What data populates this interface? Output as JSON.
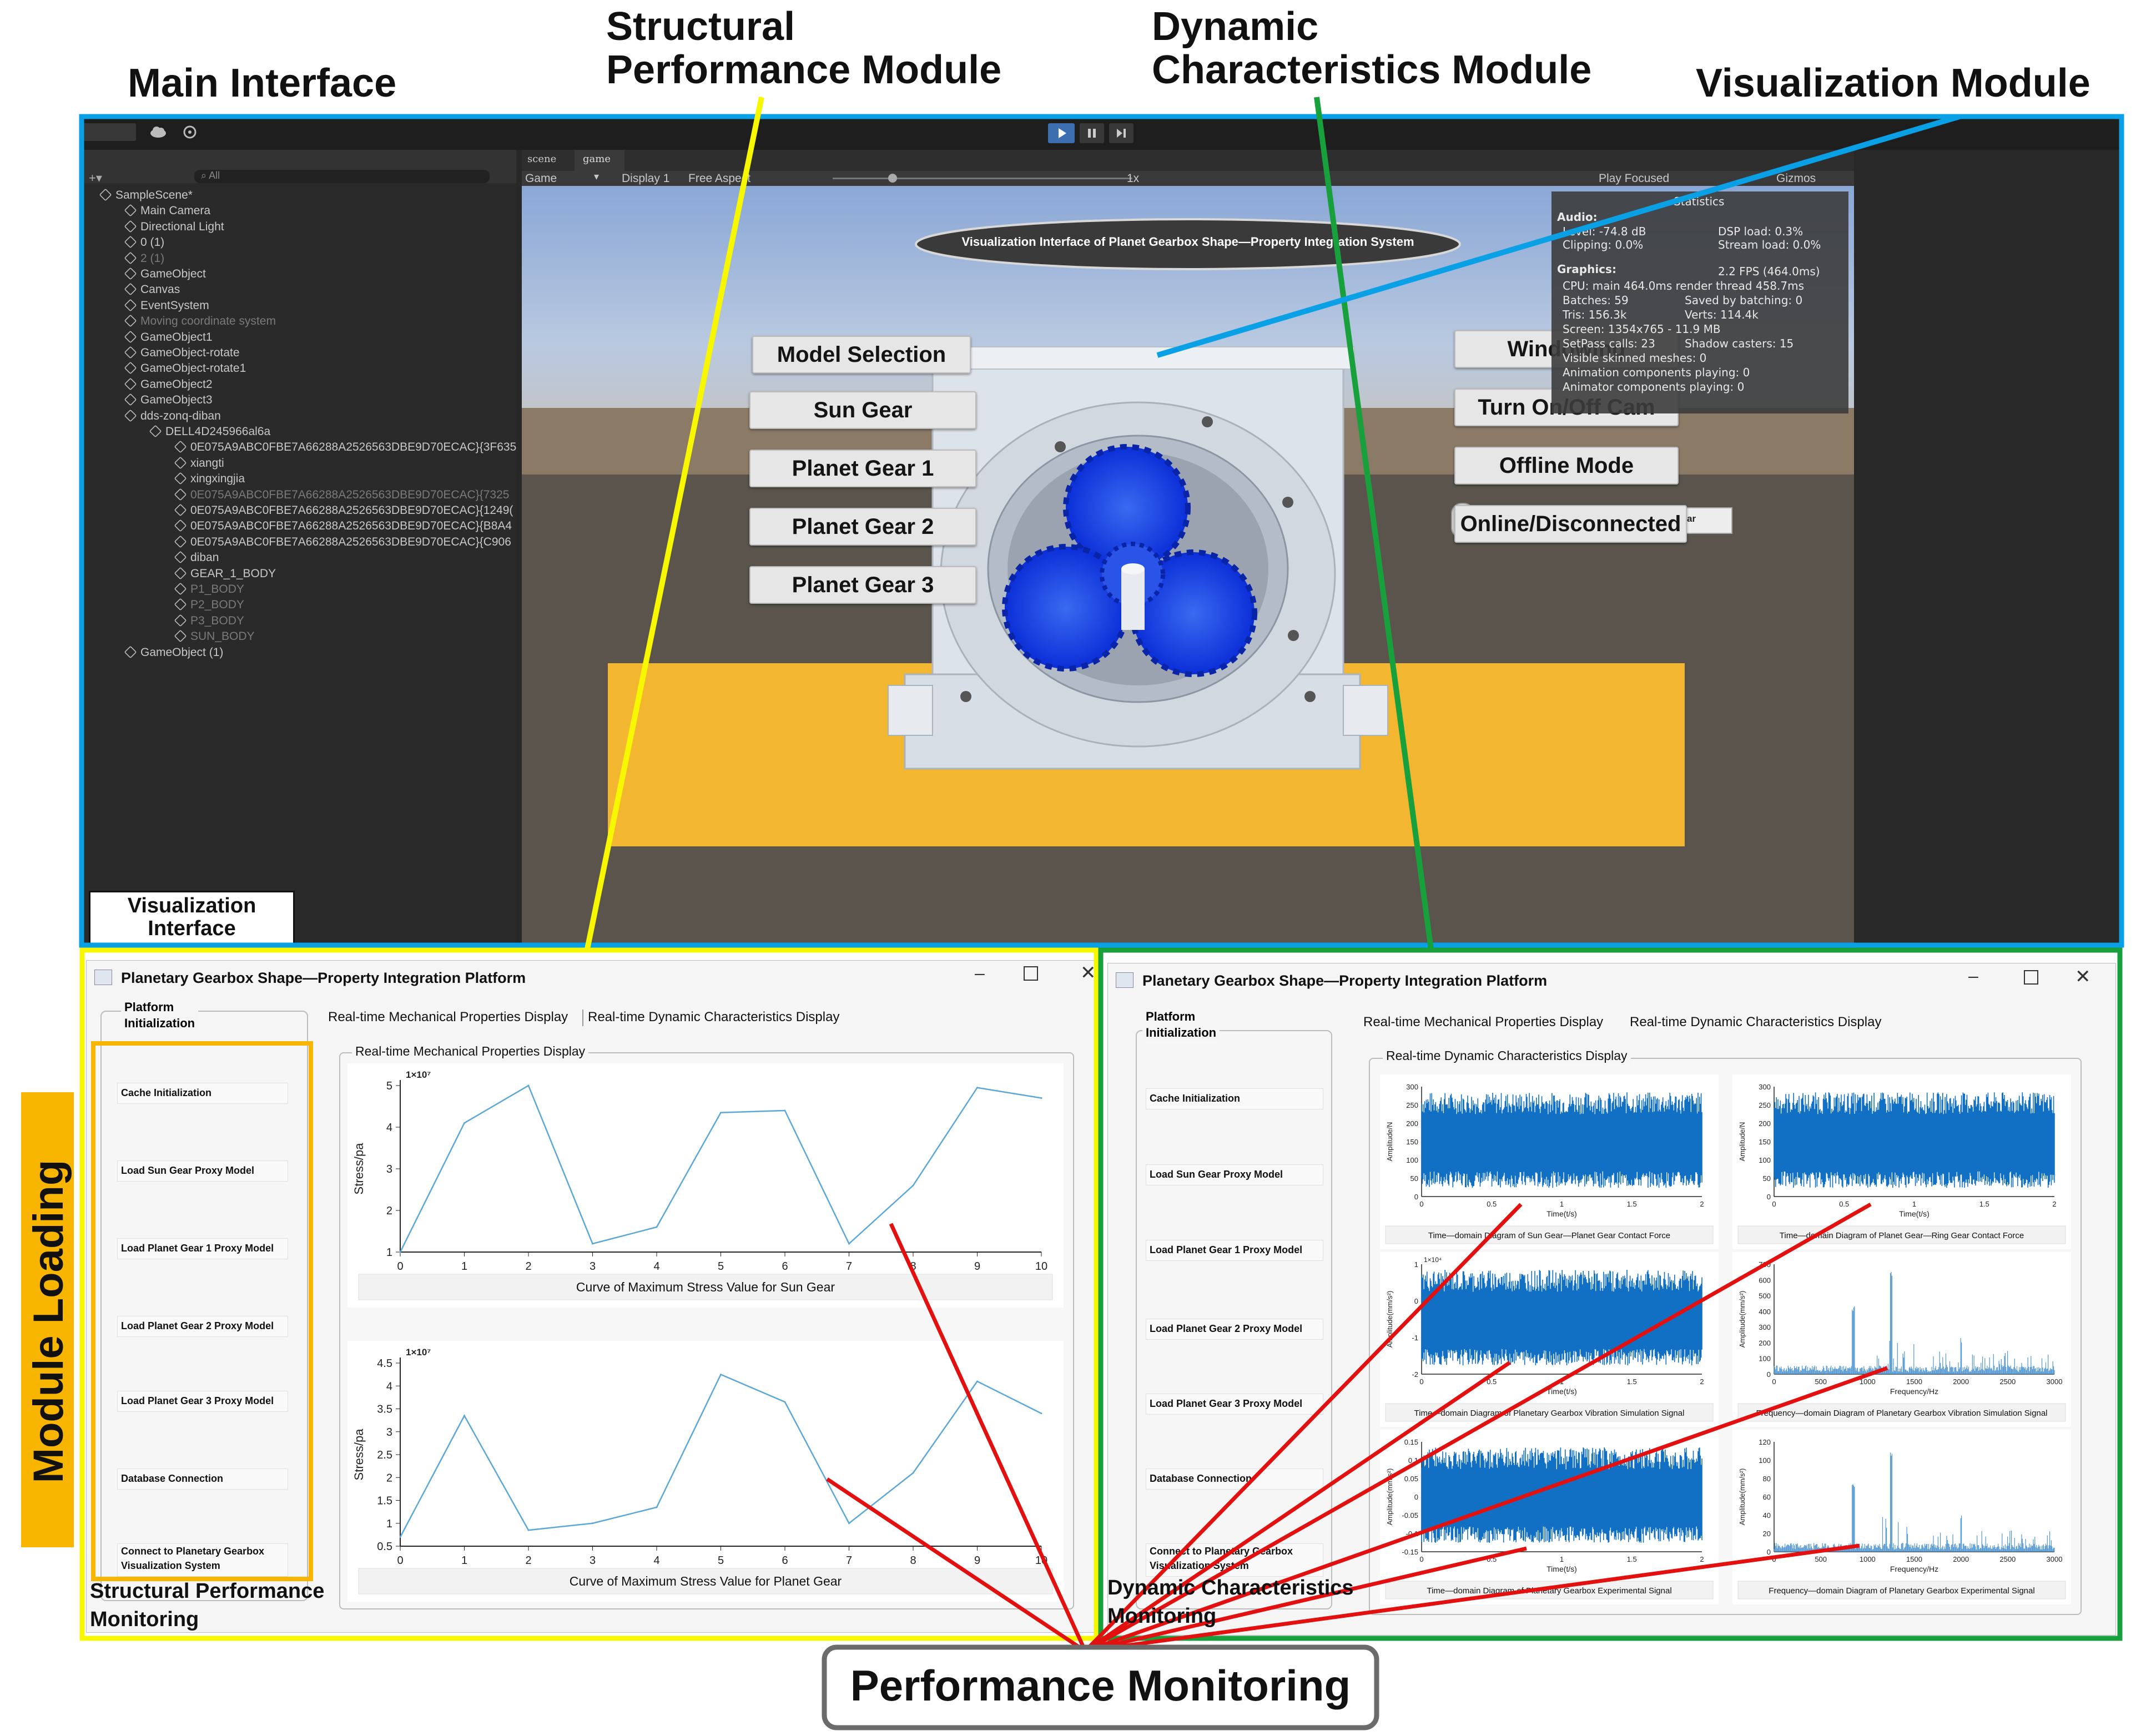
{
  "callouts": {
    "main_interface": "Main Interface",
    "structural": "Structural\nPerformance Module",
    "dynamic": "Dynamic\nCharacteristics Module",
    "visualization_module": "Visualization Module",
    "module_loading": "Module Loading",
    "visualization_interface": "Visualization\nInterface",
    "structural_monitoring": "Structural Performance\nMonitoring",
    "dynamic_monitoring": "Dynamic Characteristics\nMonitoring",
    "performance_monitoring": "Performance Monitoring"
  },
  "colors": {
    "blue_frame": "#0aa0e6",
    "yellow_frame": "#f7f700",
    "green_frame": "#17a03c",
    "orange": "#f7b500",
    "red_lines": "#e31010",
    "plot_line": "#5aa7d8",
    "signal": "#1170c4"
  },
  "unity": {
    "tabs": {
      "scene": "scene",
      "game": "game"
    },
    "toolbar": {
      "game": "Game",
      "display": "Display 1",
      "aspect": "Free Aspect",
      "scale": "1x",
      "play_focused": "Play Focused",
      "gizmos": "Gizmos",
      "search": "All"
    },
    "hierarchy": [
      {
        "label": "SampleScene*",
        "indent": 0,
        "dim": false
      },
      {
        "label": "Main Camera",
        "indent": 1,
        "dim": false
      },
      {
        "label": "Directional Light",
        "indent": 1,
        "dim": false
      },
      {
        "label": "0 (1)",
        "indent": 1,
        "dim": false
      },
      {
        "label": "2 (1)",
        "indent": 1,
        "dim": true
      },
      {
        "label": "GameObject",
        "indent": 1,
        "dim": false
      },
      {
        "label": "Canvas",
        "indent": 1,
        "dim": false
      },
      {
        "label": "EventSystem",
        "indent": 1,
        "dim": false
      },
      {
        "label": "Moving coordinate system",
        "indent": 1,
        "dim": true
      },
      {
        "label": "GameObject1",
        "indent": 1,
        "dim": false
      },
      {
        "label": "GameObject-rotate",
        "indent": 1,
        "dim": false
      },
      {
        "label": "GameObject-rotate1",
        "indent": 1,
        "dim": false
      },
      {
        "label": "GameObject2",
        "indent": 1,
        "dim": false
      },
      {
        "label": "GameObject3",
        "indent": 1,
        "dim": false
      },
      {
        "label": "dds-zonq-diban",
        "indent": 1,
        "dim": false
      },
      {
        "label": "DELL4D245966al6a",
        "indent": 2,
        "dim": false
      },
      {
        "label": "0E075A9ABC0FBE7A66288A2526563DBE9D70ECAC}{3F635",
        "indent": 3,
        "dim": false
      },
      {
        "label": "xiangti",
        "indent": 3,
        "dim": false
      },
      {
        "label": "xingxingjia",
        "indent": 3,
        "dim": false
      },
      {
        "label": "0E075A9ABC0FBE7A66288A2526563DBE9D70ECAC}{7325",
        "indent": 3,
        "dim": true
      },
      {
        "label": "0E075A9ABC0FBE7A66288A2526563DBE9D70ECAC}{1249(",
        "indent": 3,
        "dim": false
      },
      {
        "label": "0E075A9ABC0FBE7A66288A2526563DBE9D70ECAC}{B8A4",
        "indent": 3,
        "dim": false
      },
      {
        "label": "0E075A9ABC0FBE7A66288A2526563DBE9D70ECAC}{C906",
        "indent": 3,
        "dim": false
      },
      {
        "label": "diban",
        "indent": 3,
        "dim": false
      },
      {
        "label": "GEAR_1_BODY",
        "indent": 3,
        "dim": false
      },
      {
        "label": "P1_BODY",
        "indent": 3,
        "dim": true
      },
      {
        "label": "P2_BODY",
        "indent": 3,
        "dim": true
      },
      {
        "label": "P3_BODY",
        "indent": 3,
        "dim": true
      },
      {
        "label": "SUN_BODY",
        "indent": 3,
        "dim": true
      },
      {
        "label": "GameObject (1)",
        "indent": 1,
        "dim": false
      }
    ],
    "title_banner": "Visualization Interface of Planet Gearbox Shape—Property Integration System",
    "left_buttons": [
      "Model Selection",
      "Sun Gear",
      "Planet Gear 1",
      "Planet Gear 2",
      "Planet Gear 3"
    ],
    "right_buttons": [
      "Windowing",
      "Turn On/Off Cam",
      "Offline Mode",
      "Online/Disconnected"
    ],
    "slider_label": "Meshing Process of Sun Gear and Planet Gear",
    "stats": {
      "title": "Statistics",
      "audio": "Audio:",
      "level": "Level: -74.8 dB",
      "clipping": "Clipping: 0.0%",
      "dsp": "DSP load: 0.3%",
      "stream": "Stream load: 0.0%",
      "graphics": "Graphics:",
      "fps": "2.2 FPS (464.0ms)",
      "cpu": "CPU: main 464.0ms  render thread 458.7ms",
      "batches": "Batches: 59",
      "saved": "Saved by batching: 0",
      "tris": "Tris: 156.3k",
      "verts": "Verts: 114.4k",
      "screen": "Screen: 1354x765 - 11.9 MB",
      "setpass": "SetPass calls: 23",
      "shadow": "Shadow casters: 15",
      "skinned": "Visible skinned meshes: 0",
      "anim": "Animation components playing: 0",
      "animator": "Animator components playing: 0"
    }
  },
  "structural_window": {
    "title": "Planetary Gearbox Shape—Property Integration Platform",
    "sidebar_title": "Platform\nInitialization",
    "sidebar_buttons": [
      "Cache Initialization",
      "Load Sun Gear Proxy Model",
      "Load Planet Gear 1 Proxy Model",
      "Load Planet Gear 2 Proxy Model",
      "Load Planet Gear 3 Proxy Model",
      "Database Connection",
      "Connect to Planetary Gearbox\nVisualization System"
    ],
    "tabs": [
      "Real-time Mechanical Properties Display",
      "Real-time Dynamic Characteristics Display"
    ],
    "group_label": "Real-time Mechanical Properties Display"
  },
  "dynamic_window": {
    "title": "Planetary Gearbox Shape—Property Integration Platform",
    "sidebar_title": "Platform\nInitialization",
    "sidebar_buttons": [
      "Cache Initialization",
      "Load Sun Gear Proxy Model",
      "Load Planet Gear 1 Proxy Model",
      "Load Planet Gear 2 Proxy Model",
      "Load Planet Gear 3 Proxy Model",
      "Database Connection",
      "Connect to Planetary Gearbox\nVisualization System"
    ],
    "tabs": [
      "Real-time Mechanical Properties Display",
      "Real-time Dynamic Characteristics Display"
    ],
    "group_label": "Real-time Dynamic Characteristics Display",
    "captions": [
      "Time—domain Diagram of Sun Gear—Planet Gear Contact Force",
      "Time—domain Diagram of Planet Gear—Ring Gear Contact Force",
      "Time—domain Diagram of Planetary Gearbox Vibration Simulation Signal",
      "Frequency—domain Diagram of Planetary Gearbox Vibration Simulation Signal",
      "Time—domain Diagram of Planetary Gearbox Experimental Signal",
      "Frequency—domain Diagram of Planetary Gearbox Experimental Signal"
    ]
  },
  "chart_data": [
    {
      "type": "line",
      "title": "Curve of Maximum Stress Value for Sun Gear",
      "ylabel": "Stress/pa",
      "multiplier": "1×10⁷",
      "x": [
        0,
        1,
        2,
        3,
        4,
        5,
        6,
        7,
        8,
        9,
        10
      ],
      "values": [
        1.0,
        4.1,
        5.0,
        1.2,
        1.6,
        4.35,
        4.4,
        1.2,
        2.6,
        4.95,
        4.7
      ],
      "xlim": [
        0,
        10
      ],
      "ylim": [
        1,
        5
      ],
      "xticks": [
        "0",
        "1",
        "2",
        "3",
        "4",
        "5",
        "6",
        "7",
        "8",
        "9",
        "10"
      ],
      "yticks": [
        "1",
        "2",
        "3",
        "4",
        "5"
      ]
    },
    {
      "type": "line",
      "title": "Curve of Maximum Stress Value for Planet Gear",
      "ylabel": "Stress/pa",
      "multiplier": "1×10⁷",
      "x": [
        0,
        1,
        2,
        3,
        4,
        5,
        6,
        7,
        8,
        9,
        10
      ],
      "values": [
        0.7,
        3.35,
        0.85,
        1.0,
        1.35,
        4.25,
        3.65,
        1.0,
        2.1,
        4.1,
        3.4
      ],
      "xlim": [
        0,
        10
      ],
      "ylim": [
        0.5,
        4.5
      ],
      "xticks": [
        "0",
        "1",
        "2",
        "3",
        "4",
        "5",
        "6",
        "7",
        "8",
        "9",
        "10"
      ],
      "yticks": [
        "0.5",
        "1",
        "1.5",
        "2",
        "2.5",
        "3",
        "3.5",
        "4",
        "4.5"
      ]
    },
    {
      "type": "line",
      "ylabel": "Amplitude/N",
      "xlabel": "Time(t/s)",
      "ylim": [
        0,
        300
      ],
      "yticks": [
        "0",
        "50",
        "100",
        "150",
        "200",
        "250",
        "300"
      ],
      "xticks": [
        "0",
        "0.5",
        "1",
        "1.5",
        "2"
      ],
      "xlim": [
        0,
        2
      ]
    },
    {
      "type": "line",
      "ylabel": "Amplitude/N",
      "xlabel": "Time(t/s)",
      "ylim": [
        0,
        300
      ],
      "yticks": [
        "0",
        "50",
        "100",
        "150",
        "200",
        "250",
        "300"
      ],
      "xticks": [
        "0",
        "0.5",
        "1",
        "1.5",
        "2"
      ],
      "xlim": [
        0,
        2
      ]
    },
    {
      "type": "line",
      "ylabel": "Amplitude(mm/s²)",
      "xlabel": "Time(t/s)",
      "multiplier": "1×10⁴",
      "ylim": [
        -2,
        1
      ],
      "yticks": [
        "-2",
        "-1",
        "0",
        "1"
      ],
      "xticks": [
        "0",
        "0.5",
        "1",
        "1.5",
        "2"
      ],
      "xlim": [
        0,
        2
      ]
    },
    {
      "type": "line",
      "ylabel": "Amplitude(mm/s²)",
      "xlabel": "Frequency/Hz",
      "ylim": [
        0,
        700
      ],
      "yticks": [
        "0",
        "100",
        "200",
        "300",
        "400",
        "500",
        "600",
        "700"
      ],
      "xticks": [
        "0",
        "500",
        "1000",
        "1500",
        "2000",
        "2500",
        "3000"
      ],
      "xlim": [
        0,
        3000
      ]
    },
    {
      "type": "line",
      "ylabel": "Amplitude(mm/s²)",
      "xlabel": "Time(t/s)",
      "ylim": [
        -0.15,
        0.15
      ],
      "yticks": [
        "-0.15",
        "-0.1",
        "-0.05",
        "0",
        "0.05",
        "0.1",
        "0.15"
      ],
      "xticks": [
        "0",
        "0.5",
        "1",
        "1.5",
        "2"
      ],
      "xlim": [
        0,
        2
      ]
    },
    {
      "type": "line",
      "ylabel": "Amplitude(mm/s²)",
      "xlabel": "Frequency/Hz",
      "ylim": [
        0,
        120
      ],
      "yticks": [
        "0",
        "20",
        "40",
        "60",
        "80",
        "100",
        "120"
      ],
      "xticks": [
        "0",
        "500",
        "1000",
        "1500",
        "2000",
        "2500",
        "3000"
      ],
      "xlim": [
        0,
        3000
      ]
    }
  ]
}
